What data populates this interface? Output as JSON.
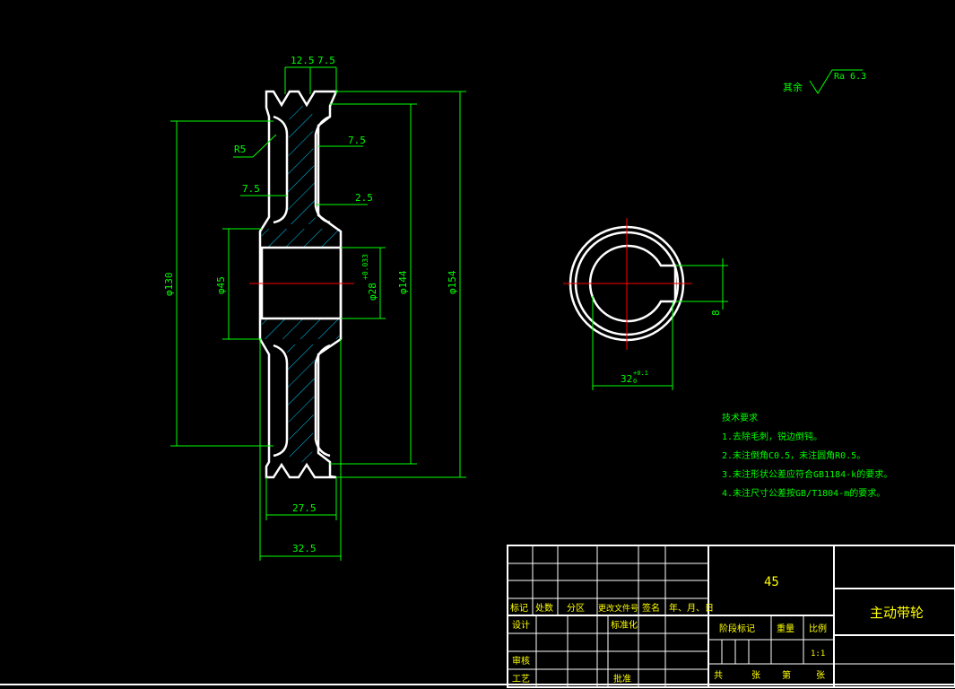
{
  "colors": {
    "background": "#000000",
    "part_outline": "#ffffff",
    "dimension": "#00ff00",
    "hatch": "#00ccff",
    "center_line": "#ff0000",
    "frame": "#ffffff",
    "annotation_text": "#00ff00",
    "title_text": "#ffff00"
  },
  "dimensions": {
    "groove_pitch": "12.5",
    "groove_edge": "7.5",
    "web_right": "7.5",
    "web_left": "7.5",
    "web_step": "2.5",
    "fillet_radius": "R5",
    "dia_130": "φ130",
    "dia_45": "φ45",
    "dia_28": "φ28",
    "dia_28_tol": "+0.033",
    "dia_144": "φ144",
    "dia_154": "φ154",
    "hub_width": "27.5",
    "overall_width": "32.5",
    "keyway_depth": "32",
    "keyway_depth_tol": "+0.1",
    "keyway_depth_tol2": "0",
    "keyway_width": "8"
  },
  "surface_finish": {
    "prefix": "其余",
    "value": "Ra 6.3"
  },
  "tech_requirements": {
    "title": "技术要求",
    "items": [
      "1.去除毛刺，锐边倒钝。",
      "2.未注倒角C0.5，未注圆角R0.5。",
      "3.未注形状公差应符合GB1184-k的要求。",
      "4.未注尺寸公差按GB/T1804-m的要求。"
    ]
  },
  "title_block": {
    "material": "45",
    "part_name": "主动带轮",
    "row_headers": [
      "标记",
      "处数",
      "分区",
      "更改文件号",
      "签名",
      "年、月、日"
    ],
    "design": "设计",
    "standardize": "标准化",
    "review": "审核",
    "process": "工艺",
    "approve": "批准",
    "stage_mark": "阶段标记",
    "weight": "重量",
    "scale": "比例",
    "scale_value": "1:1",
    "total": "共",
    "sheet_unit": "张",
    "sheet_no": "第"
  }
}
